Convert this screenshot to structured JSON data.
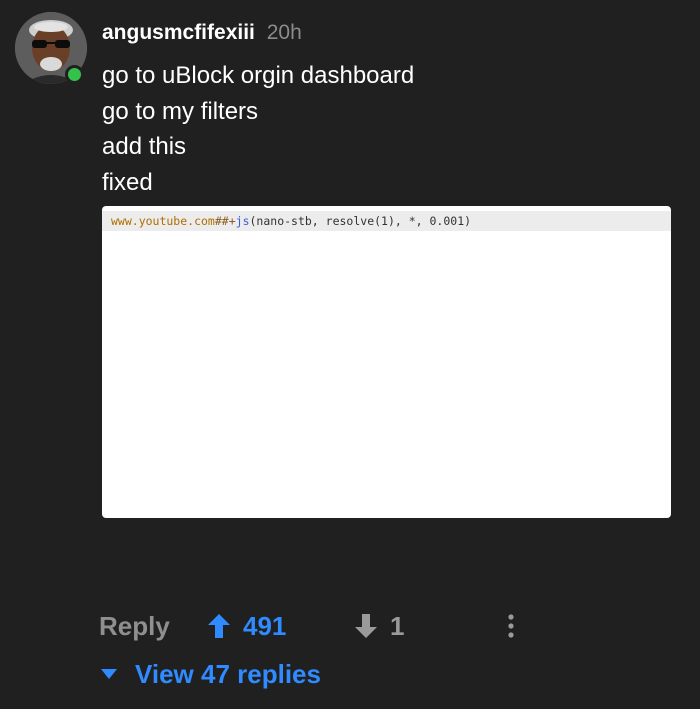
{
  "comment": {
    "username": "angusmcfifexiii",
    "timestamp": "20h",
    "avatar_icon": "user-avatar-icon",
    "online_indicator_color": "#36c24a",
    "body_lines": [
      "go to uBlock orgin dashboard",
      "go to my filters",
      "add this",
      "fixed"
    ],
    "embedded_image": {
      "code": {
        "domain": "www.youtube.com",
        "separator": "##+",
        "keyword": "js",
        "args": "(nano-stb, resolve(1), *, 0.001)"
      }
    }
  },
  "actions": {
    "reply_label": "Reply",
    "upvote_count": "491",
    "downvote_count": "1",
    "upvote_icon": "arrow-up-icon",
    "downvote_icon": "arrow-down-icon",
    "more_icon": "more-vertical-icon"
  },
  "replies": {
    "label": "View 47 replies",
    "icon": "caret-down-icon"
  },
  "colors": {
    "background": "#202020",
    "accent": "#2f8bff",
    "muted": "#8f8f8f"
  }
}
